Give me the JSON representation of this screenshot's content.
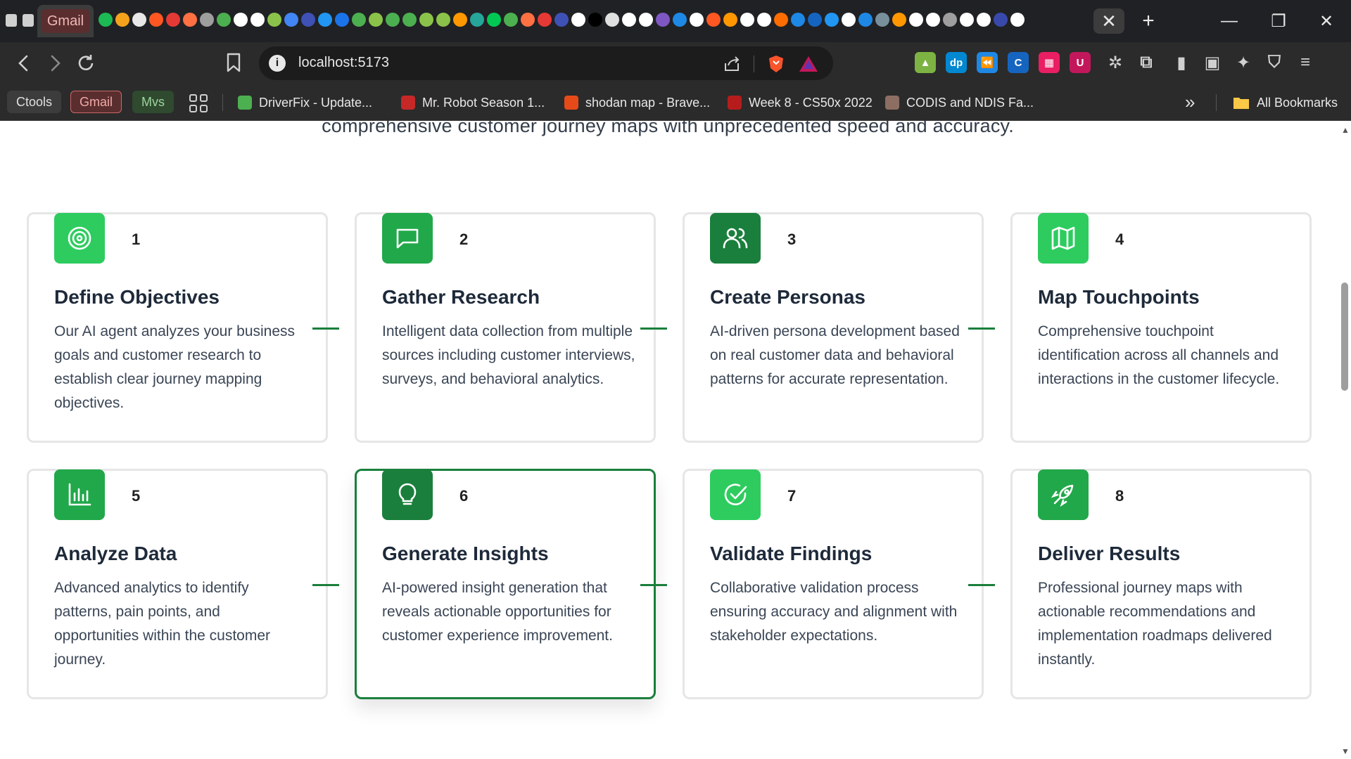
{
  "browser": {
    "active_tab_label": "Gmail",
    "close_glyph": "✕",
    "new_tab_glyph": "+",
    "minimize_glyph": "—",
    "restore_glyph": "❐",
    "window_close_glyph": "✕",
    "url": "localhost:5173",
    "favicon_colors": [
      "#1db954",
      "#f4a21c",
      "#e8e8e8",
      "#ff5722",
      "#e53935",
      "#ff7043",
      "#9e9e9e",
      "#4caf50",
      "#ffffff",
      "#ffffff",
      "#8bc34a",
      "#4285f4",
      "#3f51b5",
      "#2196f3",
      "#1a73e8",
      "#4caf50",
      "#8bc34a",
      "#4caf50",
      "#4caf50",
      "#8bc34a",
      "#8bc34a",
      "#ff9800",
      "#26a69a",
      "#00c853",
      "#4caf50",
      "#ff7043",
      "#e53935",
      "#3f51b5",
      "#ffffff",
      "#000000",
      "#e0e0e0",
      "#ffffff",
      "#ffffff",
      "#7e57c2",
      "#1e88e5",
      "#ffffff",
      "#ff5722",
      "#ff9800",
      "#ffffff",
      "#ffffff",
      "#ff6d00",
      "#1e88e5",
      "#1565c0",
      "#2196f3",
      "#ffffff",
      "#1e88e5",
      "#78909c",
      "#ff9800",
      "#ffffff",
      "#ffffff",
      "#9e9e9e",
      "#ffffff",
      "#ffffff",
      "#3949ab",
      "#ffffff"
    ],
    "extensions": [
      {
        "name": "chart-extension-icon",
        "color": "#7cb342",
        "glyph": "▲"
      },
      {
        "name": "dp-extension-icon",
        "color": "#0288d1",
        "glyph": "dp"
      },
      {
        "name": "rewind-extension-icon",
        "color": "#1e88e5",
        "glyph": "⏪"
      },
      {
        "name": "c-extension-icon",
        "color": "#1565c0",
        "glyph": "C"
      },
      {
        "name": "grid-extension-icon",
        "color": "#e91e63",
        "glyph": "▦"
      },
      {
        "name": "u-extension-icon",
        "color": "#c2185b",
        "glyph": "U"
      },
      {
        "name": "puzzle-extensions-icon",
        "color": "transparent",
        "glyph": "✲"
      },
      {
        "name": "reader-icon",
        "color": "transparent",
        "glyph": "⧉"
      },
      {
        "name": "sidebar-icon",
        "color": "transparent",
        "glyph": "▮"
      },
      {
        "name": "wallet-icon",
        "color": "transparent",
        "glyph": "▣"
      },
      {
        "name": "leo-ai-icon",
        "color": "transparent",
        "glyph": "✦"
      },
      {
        "name": "vpn-shield-icon",
        "color": "transparent",
        "glyph": "⛉"
      },
      {
        "name": "menu-icon",
        "color": "transparent",
        "glyph": "≡"
      }
    ]
  },
  "bookmarks": {
    "pills": [
      {
        "label": "Ctools",
        "bg": "#3c3c3c",
        "fg": "#e0e0e0",
        "border": "#3c3c3c"
      },
      {
        "label": "Gmail",
        "bg": "#5a2e2e",
        "fg": "#f0a8a8",
        "border": "#c66"
      },
      {
        "label": "Mvs",
        "bg": "#2f4a2f",
        "fg": "#9ed49e",
        "border": "#2f4a2f"
      }
    ],
    "items": [
      {
        "label": "DriverFix - Update...",
        "color": "#4caf50"
      },
      {
        "label": "Mr. Robot Season 1...",
        "color": "#c62828"
      },
      {
        "label": "shodan map - Brave...",
        "color": "#e64a19"
      },
      {
        "label": "Week 8 - CS50x 2022",
        "color": "#b71c1c"
      },
      {
        "label": "CODIS and NDIS Fa...",
        "color": "#8d6e63"
      }
    ],
    "overflow_glyph": "»",
    "all_bookmarks_label": "All Bookmarks"
  },
  "page": {
    "intro_text": "comprehensive customer journey maps with unprecedented speed and accuracy.",
    "accent_color": "#1a7f3c",
    "steps": [
      {
        "number": "1",
        "title": "Define Objectives",
        "description": "Our AI agent analyzes your business goals and customer research to establish clear journey mapping objectives.",
        "icon": "target-icon",
        "icon_color": "#2ecc5f"
      },
      {
        "number": "2",
        "title": "Gather Research",
        "description": "Intelligent data collection from multiple sources including customer interviews, surveys, and behavioral analytics.",
        "icon": "message-square-icon",
        "icon_color": "#21a84a"
      },
      {
        "number": "3",
        "title": "Create Personas",
        "description": "AI-driven persona development based on real customer data and behavioral patterns for accurate representation.",
        "icon": "users-icon",
        "icon_color": "#1a7f3c"
      },
      {
        "number": "4",
        "title": "Map Touchpoints",
        "description": "Comprehensive touchpoint identification across all channels and interactions in the customer lifecycle.",
        "icon": "map-icon",
        "icon_color": "#2ecc5f"
      },
      {
        "number": "5",
        "title": "Analyze Data",
        "description": "Advanced analytics to identify patterns, pain points, and opportunities within the customer journey.",
        "icon": "bar-chart-icon",
        "icon_color": "#21a84a"
      },
      {
        "number": "6",
        "title": "Generate Insights",
        "description": "AI-powered insight generation that reveals actionable opportunities for customer experience improvement.",
        "icon": "lightbulb-icon",
        "icon_color": "#1a7f3c"
      },
      {
        "number": "7",
        "title": "Validate Findings",
        "description": "Collaborative validation process ensuring accuracy and alignment with stakeholder expectations.",
        "icon": "check-circle-icon",
        "icon_color": "#2ecc5f"
      },
      {
        "number": "8",
        "title": "Deliver Results",
        "description": "Professional journey maps with actionable recommendations and implementation roadmaps delivered instantly.",
        "icon": "rocket-icon",
        "icon_color": "#21a84a"
      }
    ]
  }
}
